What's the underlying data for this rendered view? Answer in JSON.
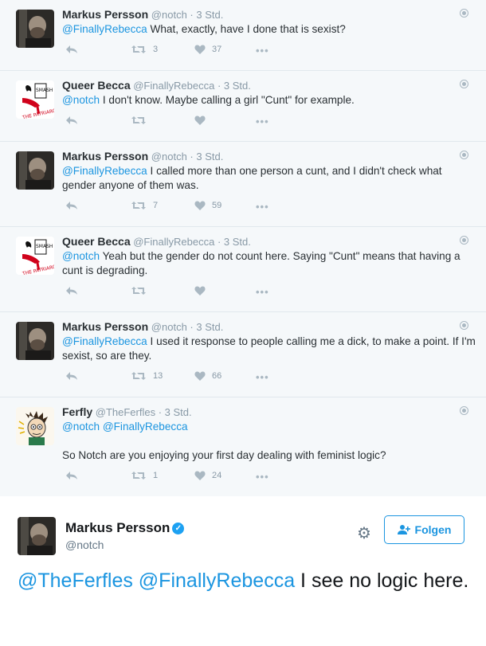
{
  "thread": [
    {
      "author": "Markus Persson",
      "handle": "@notch",
      "time": "3 Std.",
      "avatar": "notch",
      "mention": "@FinallyRebecca",
      "text": " What, exactly, have I done that is sexist?",
      "retweets": "3",
      "likes": "37"
    },
    {
      "author": "Queer Becca",
      "handle": "@FinallyRebecca",
      "time": "3 Std.",
      "avatar": "becca",
      "mention": "@notch",
      "text": " I don't know. Maybe calling a girl \"Cunt\" for example.",
      "retweets": "",
      "likes": ""
    },
    {
      "author": "Markus Persson",
      "handle": "@notch",
      "time": "3 Std.",
      "avatar": "notch",
      "mention": "@FinallyRebecca",
      "text": " I called more than one person a cunt, and I didn't check what gender anyone of them was.",
      "retweets": "7",
      "likes": "59"
    },
    {
      "author": "Queer Becca",
      "handle": "@FinallyRebecca",
      "time": "3 Std.",
      "avatar": "becca",
      "mention": "@notch",
      "text": " Yeah but the gender do not count here. Saying \"Cunt\" means that having a cunt is degrading.",
      "retweets": "",
      "likes": ""
    },
    {
      "author": "Markus Persson",
      "handle": "@notch",
      "time": "3 Std.",
      "avatar": "notch",
      "mention": "@FinallyRebecca",
      "text": " I used it response to people calling me a dick, to make a point. If I'm sexist, so are they.",
      "retweets": "13",
      "likes": "66"
    },
    {
      "author": "Ferfly",
      "handle": "@TheFerfles",
      "time": "3 Std.",
      "avatar": "ferfly",
      "mention": "@notch @FinallyRebecca",
      "text": "So Notch are you enjoying your first day dealing with feminist logic?",
      "retweets": "1",
      "likes": "24"
    }
  ],
  "main": {
    "author": "Markus Persson",
    "handle": "@notch",
    "follow_label": "Folgen",
    "mention": "@TheFerfles @FinallyRebecca",
    "text": " I see no logic here."
  },
  "colors": {
    "link": "#1b95e0",
    "thread_bg": "#f5f8fa",
    "border": "#e1e8ed",
    "muted": "#8899a6"
  }
}
